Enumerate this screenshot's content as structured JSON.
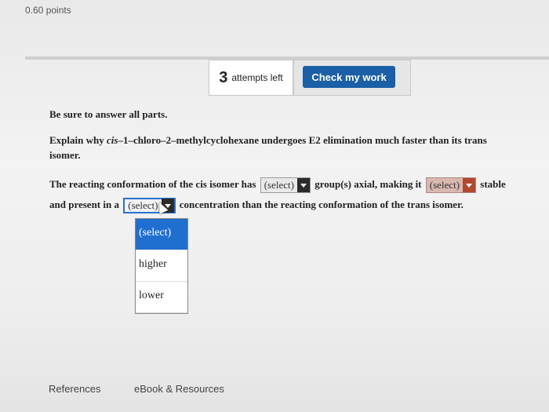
{
  "header": {
    "points": "0.60 points"
  },
  "attempts": {
    "number": "3",
    "label": "attempts left"
  },
  "check_button": {
    "label": "Check my work"
  },
  "question": {
    "instruction": "Be sure to answer all parts.",
    "prompt_line1_pre": "Explain why ",
    "prompt_italic": "cis",
    "prompt_line1_post": "–1–chloro–2–methylcyclohexane undergoes E2 elimination much faster than its trans",
    "prompt_line2": "isomer.",
    "s1_a": "The reacting conformation of the cis isomer has",
    "s1_b": "group(s) axial, making it",
    "s1_c": "stable",
    "s2_a": "and present in a",
    "s2_b": "concentration than the reacting conformation of the trans isomer."
  },
  "selects": {
    "s1": "(select)",
    "s2": "(select)",
    "s3": "(select)"
  },
  "dropdown": {
    "options": [
      "(select)",
      "higher",
      "lower"
    ]
  },
  "footer": {
    "references": "References",
    "ebook": "eBook & Resources"
  },
  "colors": {
    "button": "#1b5fa6",
    "selected_option": "#1f6fd0"
  }
}
